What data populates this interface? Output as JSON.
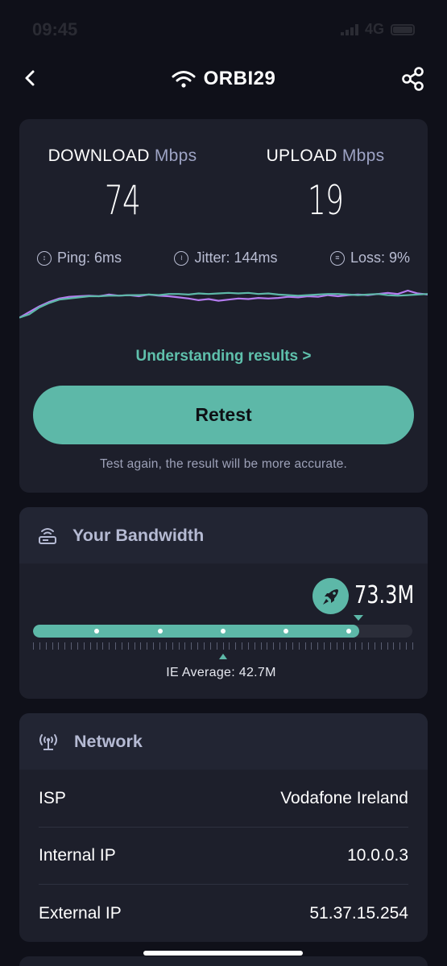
{
  "status_bar": {
    "time": "09:45",
    "network": "4G"
  },
  "nav": {
    "title": "ORBI29"
  },
  "speed": {
    "download_label": "DOWNLOAD",
    "upload_label": "UPLOAD",
    "unit": "Mbps",
    "download_value": "74",
    "upload_value": "19"
  },
  "metrics": {
    "ping": "Ping: 6ms",
    "jitter": "Jitter: 144ms",
    "loss": "Loss: 9%"
  },
  "graph": {
    "download_color": "#5db8a8",
    "upload_color": "#b57cf0",
    "download_series": [
      42,
      48,
      60,
      68,
      74,
      76,
      78,
      80,
      80,
      81,
      81,
      82,
      82,
      83,
      82,
      84,
      84,
      83,
      85,
      84,
      85,
      86,
      85,
      86,
      84,
      85,
      83,
      82,
      81,
      82,
      83,
      84,
      84,
      83,
      82,
      83,
      84,
      82,
      81,
      82,
      83,
      84
    ],
    "upload_series": [
      42,
      52,
      62,
      70,
      76,
      79,
      80,
      81,
      80,
      83,
      81,
      82,
      80,
      83,
      81,
      80,
      78,
      76,
      73,
      75,
      72,
      74,
      76,
      75,
      77,
      76,
      77,
      79,
      78,
      80,
      79,
      82,
      80,
      82,
      83,
      82,
      84,
      86,
      84,
      90,
      85,
      83
    ]
  },
  "links": {
    "understanding": "Understanding results  >"
  },
  "retest": {
    "button_label": "Retest",
    "note": "Test again, the result will be more accurate."
  },
  "bandwidth": {
    "title": "Your Bandwidth",
    "value": "73.3M",
    "fill_fraction": 0.86,
    "average_label": "IE Average: 42.7M",
    "average_fraction": 0.5
  },
  "network": {
    "title": "Network",
    "rows": [
      {
        "label": "ISP",
        "value": "Vodafone Ireland"
      },
      {
        "label": "Internal IP",
        "value": "10.0.0.3"
      },
      {
        "label": "External IP",
        "value": "51.37.15.254"
      }
    ]
  },
  "colors": {
    "accent": "#5db8a8",
    "background": "#0f1019",
    "card": "#1d1f2b"
  },
  "icons": {
    "back": "chevron-left-icon",
    "wifi": "wifi-icon",
    "share": "share-icon",
    "ping": "ping-icon",
    "jitter": "jitter-icon",
    "loss": "loss-icon",
    "router": "router-icon",
    "rocket": "rocket-icon",
    "antenna": "antenna-icon"
  }
}
